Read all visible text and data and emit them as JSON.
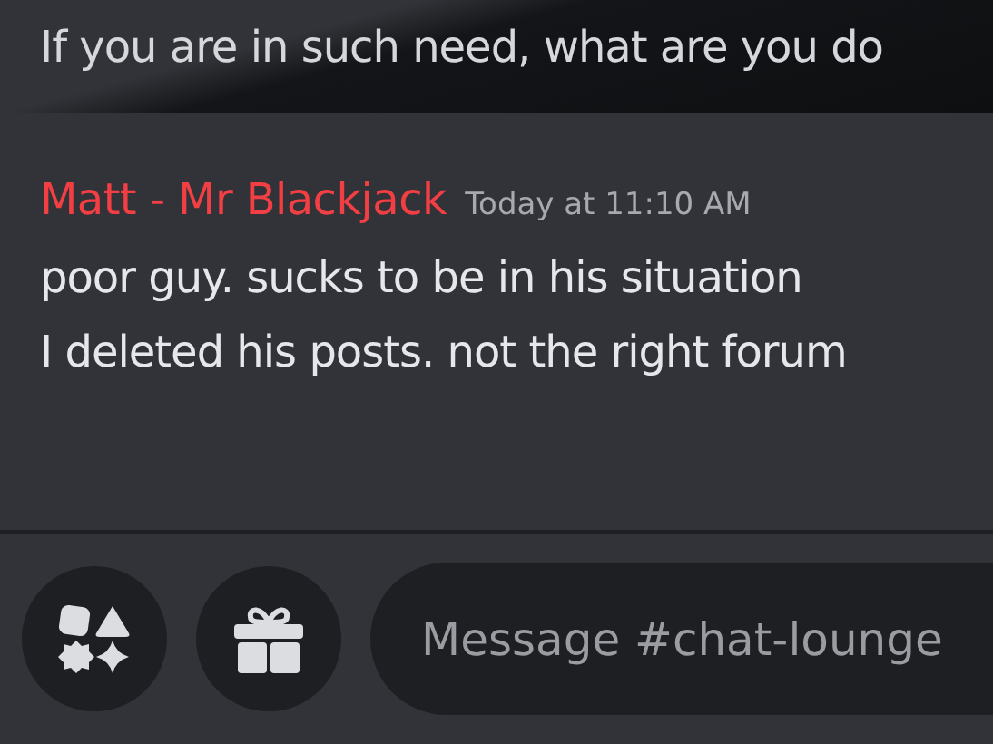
{
  "previous_message": {
    "text": "If you are in such need, what are you do"
  },
  "message": {
    "author": "Matt - Mr Blackjack",
    "color": "#f23f43",
    "timestamp": "Today at 11:10 AM",
    "lines": [
      "poor guy. sucks to be in his situation",
      "I deleted his posts. not the right forum"
    ]
  },
  "composer": {
    "placeholder": "Message #chat-lounge"
  }
}
